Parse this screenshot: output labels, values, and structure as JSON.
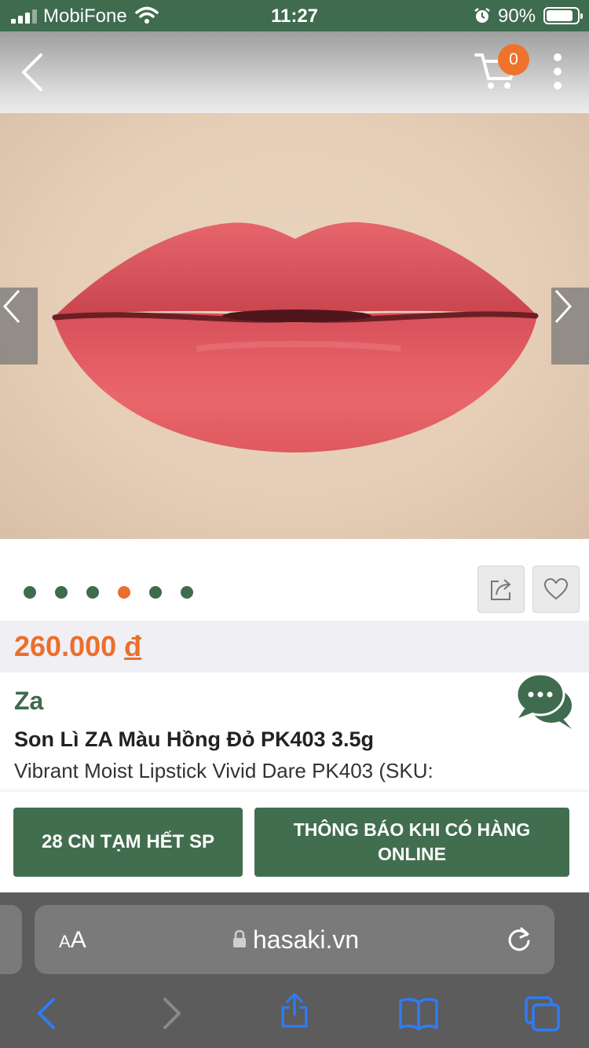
{
  "status_bar": {
    "carrier": "MobiFone",
    "time": "11:27",
    "battery": "90%"
  },
  "header": {
    "cart_count": "0"
  },
  "gallery": {
    "image_count": 6,
    "active_index": 3
  },
  "product": {
    "price": "260.000",
    "currency": "đ",
    "brand": "Za",
    "name": "Son Lì ZA Màu Hồng Đỏ PK403 3.5g",
    "subtitle": "Vibrant Moist Lipstick Vivid Dare PK403 (SKU:"
  },
  "actions": {
    "stock_label": "28 CN TẠM HẾT SP",
    "notify_label": "THÔNG BÁO KHI CÓ HÀNG ONLINE"
  },
  "browser": {
    "text_size_label": "AA",
    "domain": "hasaki.vn"
  },
  "colors": {
    "brand_green": "#3f6b4f",
    "accent_orange": "#ec6e2c",
    "safari_gray": "#5c5c5c"
  },
  "icons": [
    "back-icon",
    "cart-icon",
    "more-icon",
    "chevron-left-icon",
    "chevron-right-icon",
    "share-icon",
    "heart-icon",
    "chat-icon",
    "lock-icon",
    "reload-icon",
    "safari-back-icon",
    "safari-forward-icon",
    "safari-share-icon",
    "bookmarks-icon",
    "tabs-icon"
  ]
}
